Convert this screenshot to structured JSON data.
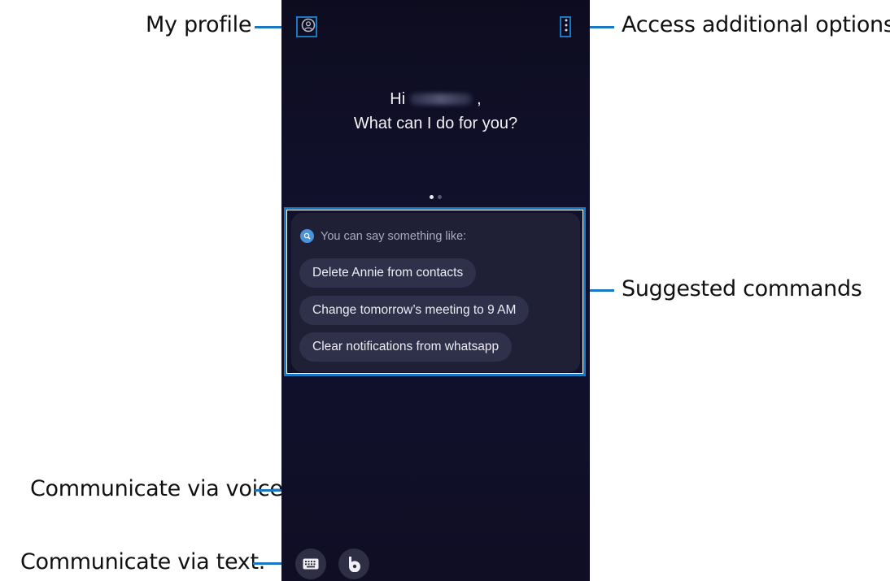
{
  "callouts": {
    "my_profile": "My profile",
    "more_options": "Access additional options.",
    "suggested": "Suggested commands",
    "voice": "Communicate via voice.",
    "text": "Communicate via text."
  },
  "screen": {
    "greeting_hi": "Hi",
    "greeting_comma": ",",
    "greeting_question": "What can I do for you?",
    "hint": "You can say something like:",
    "commands": [
      "Delete Annie from contacts",
      "Change tomorrow’s meeting to 9 AM",
      "Clear notifications from whatsapp"
    ],
    "page_count": 2,
    "active_page": 1
  },
  "icons": {
    "profile": "profile-icon",
    "more": "more-vertical-icon",
    "hint": "search-icon",
    "keyboard": "keyboard-icon",
    "bixby": "bixby-icon"
  },
  "colors": {
    "leader": "#1a78c2",
    "background": "#0f0e24",
    "chip": "#2f3049",
    "card": "#1f2036"
  }
}
